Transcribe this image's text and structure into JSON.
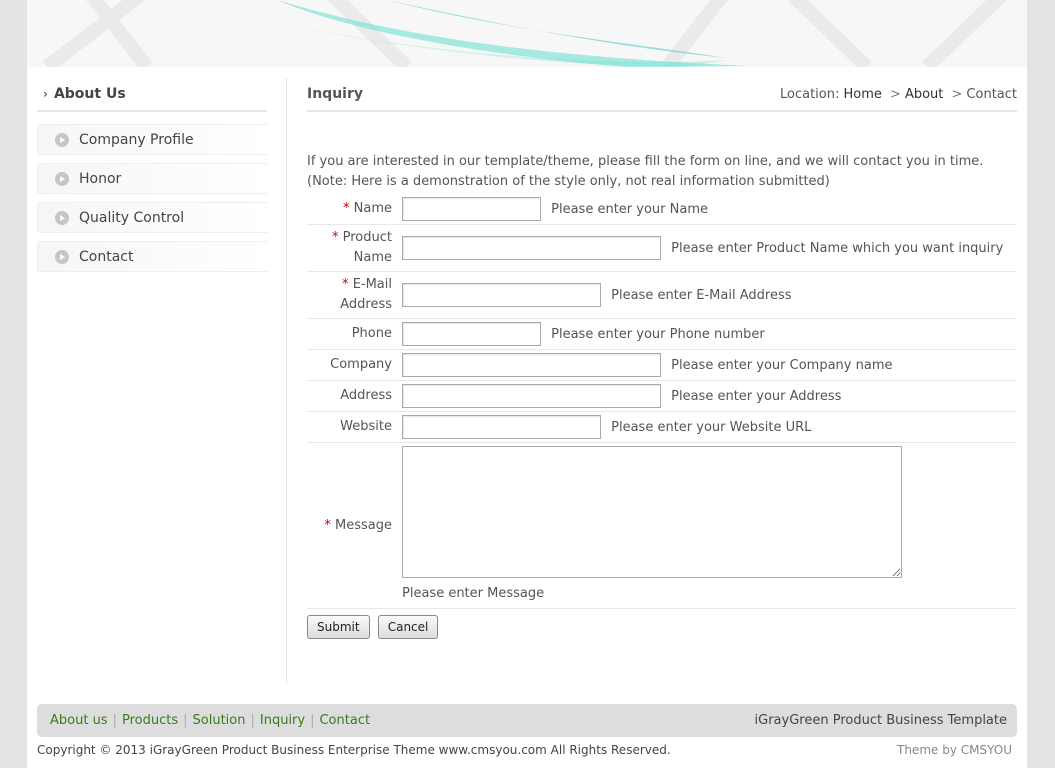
{
  "sidebar": {
    "title": "About Us",
    "items": [
      {
        "label": "Company Profile"
      },
      {
        "label": "Honor"
      },
      {
        "label": "Quality Control"
      },
      {
        "label": "Contact"
      }
    ]
  },
  "main": {
    "title": "Inquiry",
    "breadcrumb": {
      "prefix": "Location:",
      "items": [
        "Home",
        "About",
        "Contact"
      ],
      "separator": ">"
    },
    "intro_line1": "If you are interested in our template/theme, please fill the form on line, and we will contact you in time.",
    "intro_line2": "(Note: Here is a demonstration of the style only, not real information submitted)"
  },
  "form": {
    "required_mark": "*",
    "name": {
      "label": "Name",
      "value": "",
      "hint": "Please enter your Name"
    },
    "product": {
      "label_line1": "Product",
      "label_line2": "Name",
      "value": "",
      "hint": "Please enter Product Name which you want inquiry"
    },
    "email": {
      "label_line1": "E-Mail",
      "label_line2": "Address",
      "value": "",
      "hint": "Please enter E-Mail Address"
    },
    "phone": {
      "label": "Phone",
      "value": "",
      "hint": "Please enter your Phone number"
    },
    "company": {
      "label": "Company",
      "value": "",
      "hint": "Please enter your Company name"
    },
    "address": {
      "label": "Address",
      "value": "",
      "hint": "Please enter your Address"
    },
    "website": {
      "label": "Website",
      "value": "",
      "hint": "Please enter your Website URL"
    },
    "message": {
      "label": "Message",
      "value": "",
      "hint": "Please enter Message"
    },
    "submit_label": "Submit",
    "cancel_label": "Cancel"
  },
  "footer": {
    "links": [
      "About us",
      "Products",
      "Solution",
      "Inquiry",
      "Contact"
    ],
    "separator": "|",
    "template_name": "iGrayGreen Product Business Template",
    "copyright": "Copyright © 2013 iGrayGreen Product Business Enterprise Theme www.cmsyou.com All Rights Reserved.",
    "theme_credit": "Theme by CMSYOU"
  },
  "colors": {
    "footer_link": "#3a7a1f",
    "required": "#cc0000",
    "banner_accent": "#4fd6c4"
  },
  "icons": {
    "sidebar_header": "chevron-right-icon",
    "sidebar_bullet": "circle-arrow-icon"
  }
}
